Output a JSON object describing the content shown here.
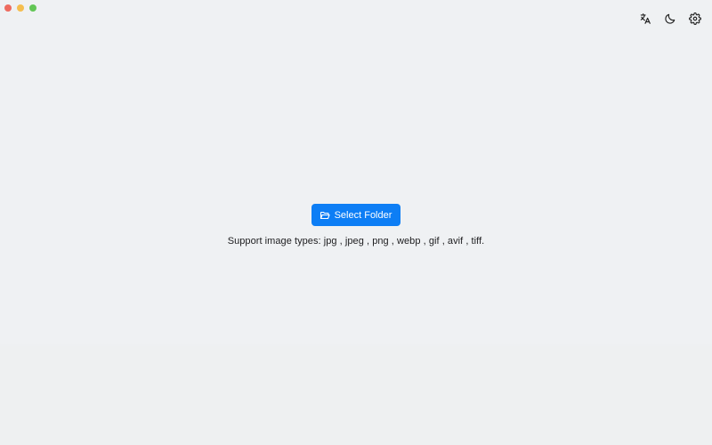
{
  "window": {
    "controls": [
      "close",
      "minimize",
      "zoom"
    ],
    "colors": {
      "close": "#ee6b5f",
      "minimize": "#f5be4f",
      "zoom": "#62c655"
    }
  },
  "toolbar": {
    "items": [
      {
        "name": "translate",
        "icon": "translate-icon"
      },
      {
        "name": "theme",
        "icon": "moon-icon"
      },
      {
        "name": "settings",
        "icon": "gear-icon"
      }
    ]
  },
  "main": {
    "select_button": {
      "label": "Select Folder",
      "icon": "folder-open-icon",
      "color": "#0d7ef5"
    },
    "support_text": "Support image types: jpg , jpeg , png , webp , gif , avif , tiff."
  }
}
